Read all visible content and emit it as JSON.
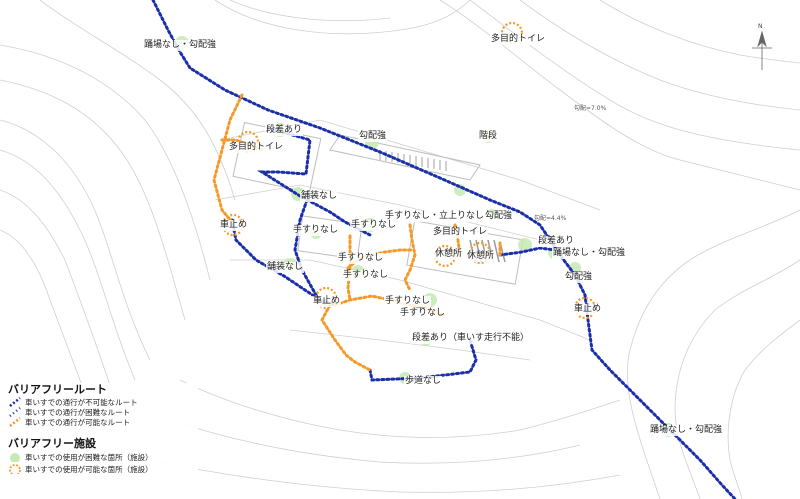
{
  "colors": {
    "impossible": "#1a2fa8",
    "possible": "#f39a2a",
    "difficult_facility": "#b9e6a3",
    "base_line": "#c7c7c7",
    "contour": "#d8d8d8"
  },
  "map_labels": {
    "steep_top": "踊場なし・勾配強",
    "toilet_top": "多目的トイレ",
    "slope_7": "勾配=7.0%",
    "step_1": "段差あり",
    "slope_1": "勾配強",
    "stairs": "階段",
    "toilet_left": "多目的トイレ",
    "pave_1": "舗装なし",
    "handrail_stand": "手すりなし・立上りなし",
    "slope_2": "勾配強",
    "slope_44": "勾配=4.4%",
    "car_stop_1": "車止め",
    "handrail_1": "手すりなし",
    "handrail_2": "手すりなし",
    "toilet_mid": "多目的トイレ",
    "step_2": "段差あり",
    "rest_1": "休憩所",
    "rest_2": "休憩所",
    "steep_mid": "踊場なし・勾配強",
    "handrail_3": "手すりなし",
    "pave_2": "舗装なし",
    "handrail_4": "手すりなし",
    "slope_3": "勾配強",
    "car_stop_2": "車止め",
    "handrail_5": "手すりなし",
    "handrail_6": "手すりなし",
    "car_stop_3": "車止め",
    "step_wheel": "段差あり（車いす走行不能）",
    "sidewalk": "歩道なし",
    "steep_bottom": "踊場なし・勾配強"
  },
  "legend": {
    "route_title": "バリアフリールート",
    "route_impossible": "車いすでの通行が不可能なルート",
    "route_difficult": "車いすでの通行が困難なルート",
    "route_possible": "車いすでの通行が可能なルート",
    "facility_title": "バリアフリー施設",
    "facility_difficult": "車いすでの使用が困難な箇所（施設）",
    "facility_possible": "車いすでの使用が可能な箇所（施設）"
  },
  "north": "N"
}
